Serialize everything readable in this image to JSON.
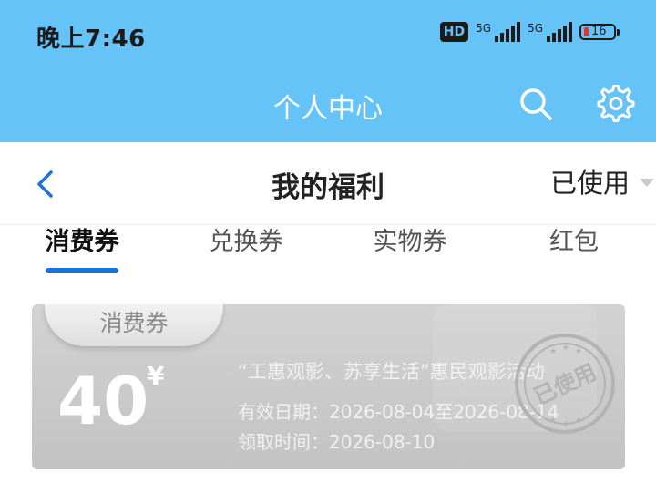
{
  "status_bar": {
    "time": "晚上7:46",
    "hd_label": "HD",
    "network_1": "5G",
    "network_2": "5G",
    "battery_level": "16"
  },
  "app_header": {
    "title": "个人中心"
  },
  "nav_bar": {
    "title": "我的福利",
    "filter_label": "已使用"
  },
  "tabs": [
    {
      "label": "消费券",
      "active": true
    },
    {
      "label": "兑换券",
      "active": false
    },
    {
      "label": "实物券",
      "active": false
    },
    {
      "label": "红包",
      "active": false
    }
  ],
  "coupon": {
    "tag": "消费券",
    "amount": "40",
    "currency": "¥",
    "title": "“工惠观影、苏享生活”惠民观影活动",
    "valid_period": "有效日期：2026-08-04至2026-08-14",
    "claim_time": "领取时间：2026-08-10",
    "stamp_text": "已使用"
  },
  "colors": {
    "header_bg": "#66c3f8",
    "tab_indicator": "#1a73d9",
    "back_arrow": "#1a73d9",
    "coupon_bg": "#c8c8c8"
  }
}
